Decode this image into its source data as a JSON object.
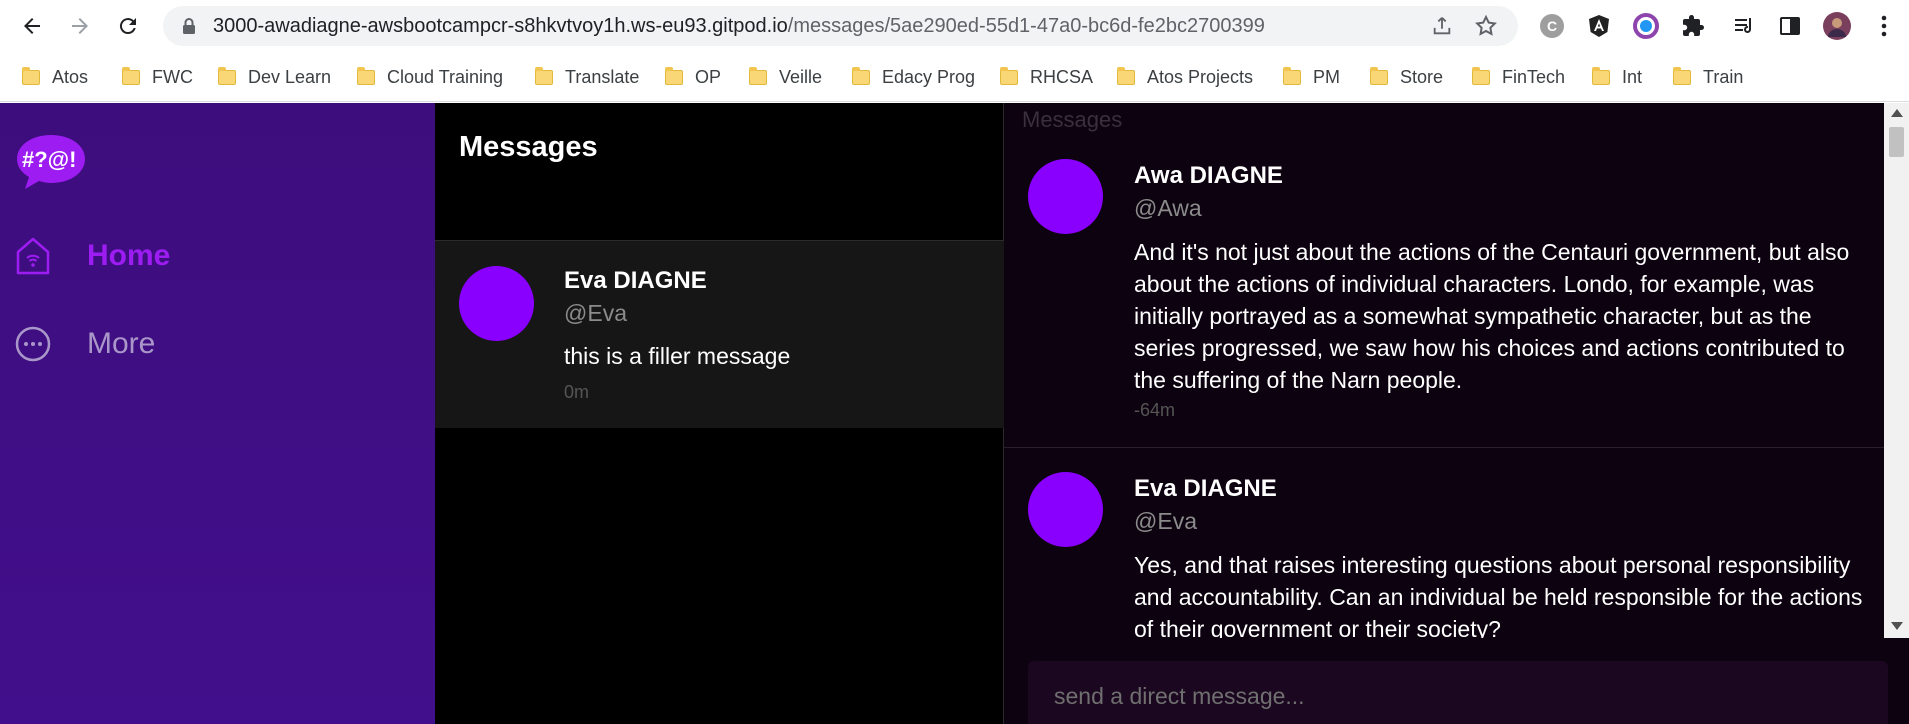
{
  "browser": {
    "url_host": "3000-awadiagne-awsbootcampcr-s8hkvtvoy1h.ws-eu93.gitpod.io",
    "url_path": "/messages/5ae290ed-55d1-47a0-bc6d-fe2bc2700399",
    "bookmarks": [
      {
        "label": "Atos"
      },
      {
        "label": "FWC"
      },
      {
        "label": "Dev Learn"
      },
      {
        "label": "Cloud Training"
      },
      {
        "label": "Translate"
      },
      {
        "label": "OP"
      },
      {
        "label": "Veille"
      },
      {
        "label": "Edacy Prog"
      },
      {
        "label": "RHCSA"
      },
      {
        "label": "Atos Projects"
      },
      {
        "label": "PM"
      },
      {
        "label": "Store"
      },
      {
        "label": "FinTech"
      },
      {
        "label": "Int"
      },
      {
        "label": "Train"
      }
    ]
  },
  "sidebar": {
    "logo_text": "#?@!",
    "items": [
      {
        "label": "Home",
        "icon": "home-icon",
        "active": true
      },
      {
        "label": "More",
        "icon": "more-icon",
        "active": false
      }
    ]
  },
  "message_groups": {
    "title": "Messages",
    "items": [
      {
        "name": "Eva DIAGNE",
        "handle": "@Eva",
        "message": "this is a filler message",
        "time": "0m"
      }
    ]
  },
  "conversation": {
    "heading": "Messages",
    "messages": [
      {
        "name": "Awa DIAGNE",
        "handle": "@Awa",
        "message": "And it's not just about the actions of the Centauri government, but also about the actions of individual characters. Londo, for example, was initially portrayed as a somewhat sympathetic character, but as the series progressed, we saw how his choices and actions contributed to the suffering of the Narn people.",
        "time": "-64m"
      },
      {
        "name": "Eva DIAGNE",
        "handle": "@Eva",
        "message": "Yes, and that raises interesting questions about personal responsibility and accountability. Can an individual be held responsible for the actions of their government or their society?",
        "time": ""
      }
    ],
    "composer_placeholder": "send a direct message..."
  },
  "colors": {
    "accent": "#9c1cf2",
    "avatar": "#8a00ff",
    "sidebar_bg": "#3d0d7d"
  }
}
